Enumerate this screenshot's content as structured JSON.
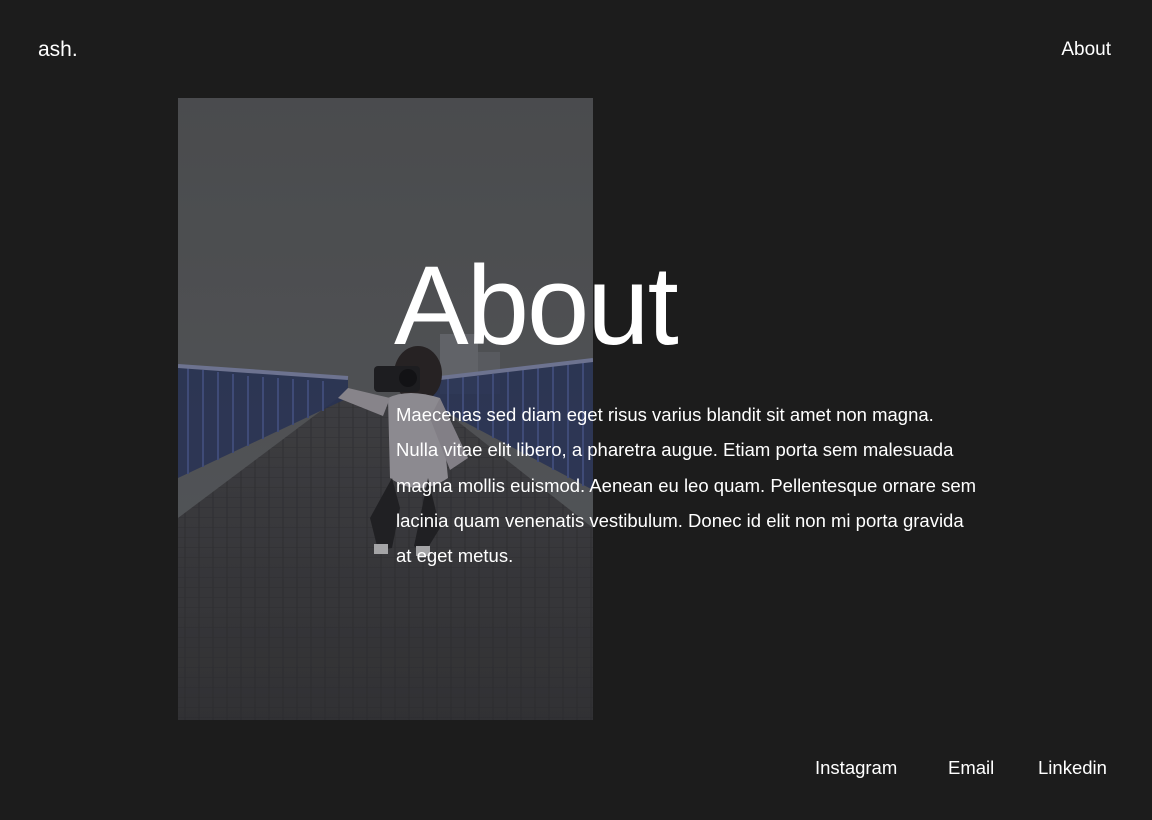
{
  "header": {
    "logo": "ash.",
    "nav_about": "About"
  },
  "main": {
    "title": "About",
    "body": "Maecenas sed diam eget risus varius blandit sit amet non magna. Nulla vitae elit libero, a pharetra augue. Etiam porta sem malesuada magna mollis euismod. Aenean eu leo quam. Pellentesque ornare sem lacinia quam venenatis vestibulum. Donec id elit non mi porta gravida at eget metus."
  },
  "footer": {
    "links": [
      "Instagram",
      "Email",
      "Linkedin"
    ]
  },
  "colors": {
    "background": "#1c1c1c",
    "text": "#ffffff"
  }
}
